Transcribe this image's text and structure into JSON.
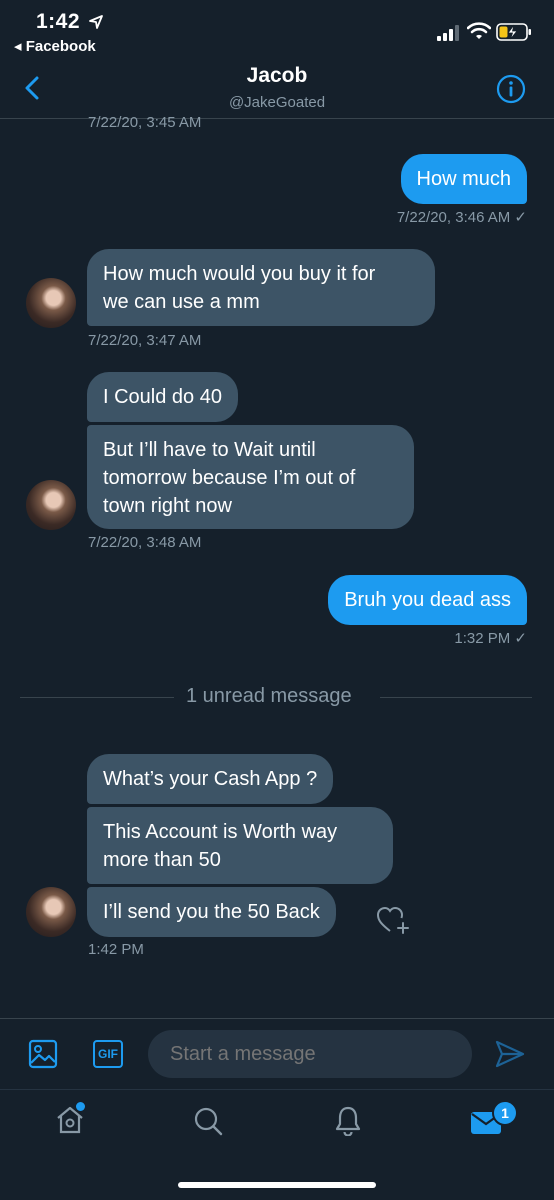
{
  "status_bar": {
    "time": "1:42",
    "back_app": "◂ Facebook"
  },
  "header": {
    "name": "Jacob",
    "handle": "@JakeGoated"
  },
  "messages": [
    {
      "kind": "timestamp",
      "text": "7/22/20, 3:45 AM"
    },
    {
      "kind": "outgoing",
      "text": "How much",
      "time": "7/22/20, 3:46 AM ✓"
    },
    {
      "kind": "incoming",
      "text_lines": [
        "How much would you buy it for",
        "we can use a mm"
      ],
      "time": "7/22/20, 3:47 AM"
    },
    {
      "kind": "incoming",
      "text": "I Could do 40"
    },
    {
      "kind": "incoming",
      "text_lines": [
        "But I’ll have to Wait until",
        "tomorrow because I’m out of",
        "town right now"
      ],
      "time": "7/22/20, 3:48 AM"
    },
    {
      "kind": "outgoing",
      "text": "Bruh you dead ass",
      "time": "1:32 PM ✓"
    },
    {
      "kind": "divider",
      "text": "1 unread message"
    },
    {
      "kind": "incoming",
      "text": "What’s your Cash App ?"
    },
    {
      "kind": "incoming",
      "text_lines": [
        "This Account is Worth way",
        "more than 50"
      ]
    },
    {
      "kind": "incoming",
      "text": "I’ll send you the 50 Back",
      "time": "1:42 PM"
    }
  ],
  "composer": {
    "placeholder": "Start a message",
    "gif_label": "GIF"
  },
  "tabbar": {
    "messages_badge": "1"
  },
  "colors": {
    "background": "#15202b",
    "accent": "#1d9bf0",
    "incoming_bubble": "#3d5466",
    "secondary_text": "#8899a6"
  }
}
